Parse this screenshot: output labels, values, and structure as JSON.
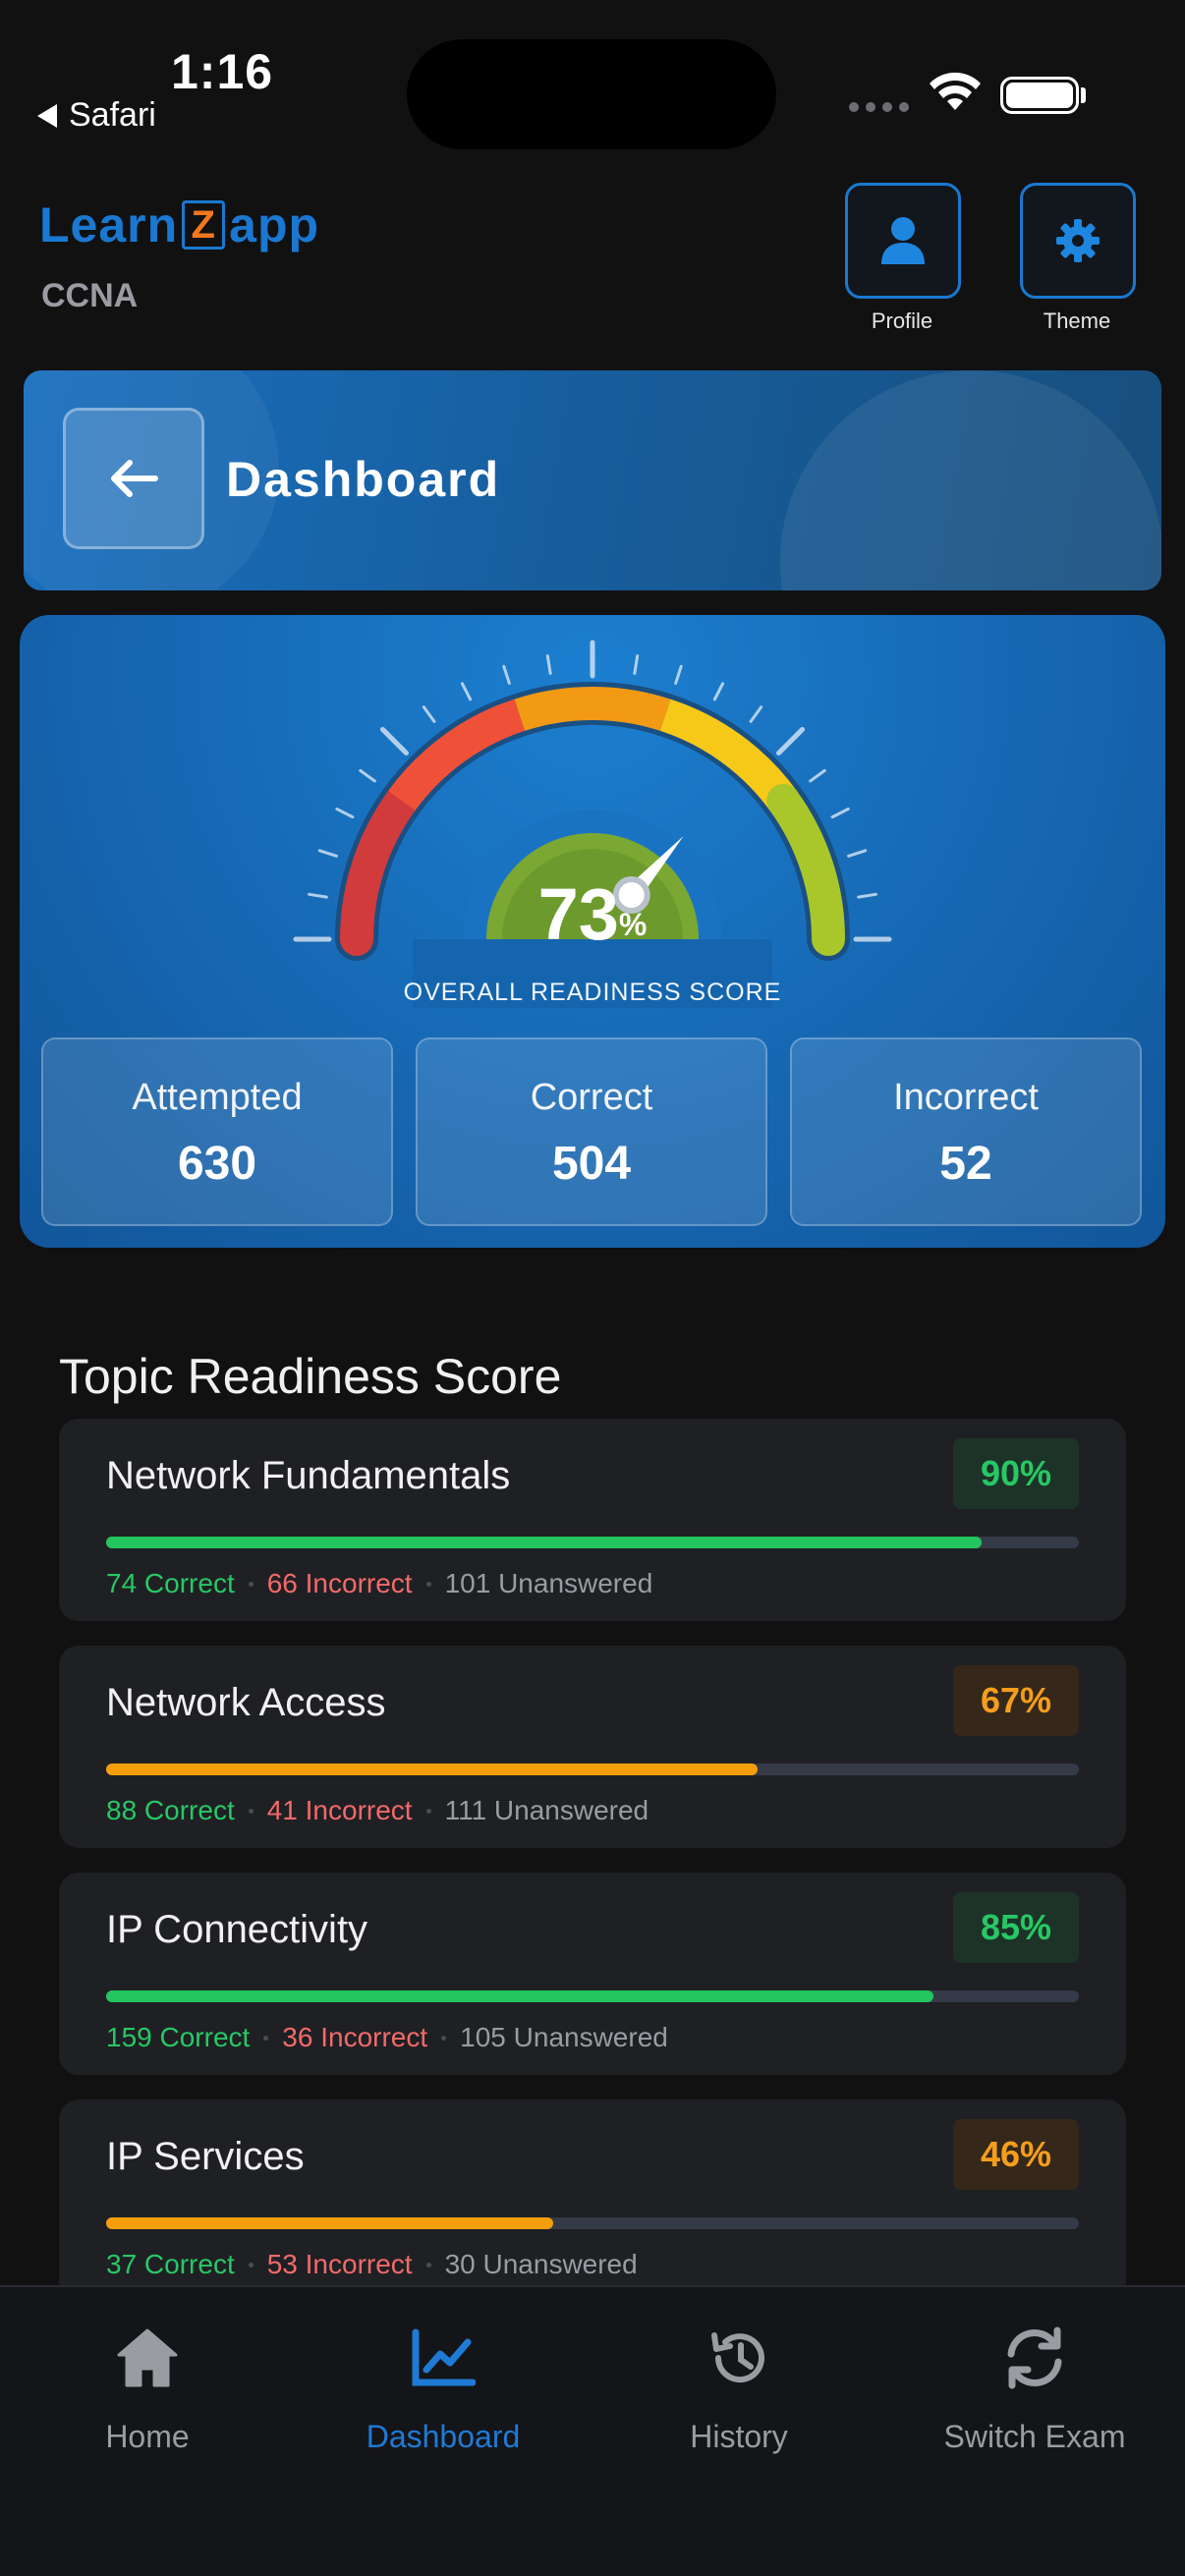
{
  "status_bar": {
    "time": "1:16",
    "back_app": "Safari"
  },
  "header": {
    "logo": {
      "part1": "Learn",
      "part2": "Z",
      "part3": "app"
    },
    "exam": "CCNA",
    "profile_label": "Profile",
    "theme_label": "Theme"
  },
  "banner": {
    "title": "Dashboard"
  },
  "readiness": {
    "score": "73",
    "unit": "%",
    "score_value": 73,
    "label": "OVERALL READINESS SCORE",
    "stats": [
      {
        "label": "Attempted",
        "value": "630"
      },
      {
        "label": "Correct",
        "value": "504"
      },
      {
        "label": "Incorrect",
        "value": "52"
      }
    ]
  },
  "topics_section": {
    "title": "Topic Readiness Score",
    "topics": [
      {
        "name": "Network Fundamentals",
        "pct": "90%",
        "progress": 0.9,
        "level": "green",
        "correct": "74 Correct",
        "incorrect": "66 Incorrect",
        "unanswered": "101 Unanswered"
      },
      {
        "name": "Network Access",
        "pct": "67%",
        "progress": 0.67,
        "level": "orange",
        "correct": "88 Correct",
        "incorrect": "41 Incorrect",
        "unanswered": "111 Unanswered"
      },
      {
        "name": "IP Connectivity",
        "pct": "85%",
        "progress": 0.85,
        "level": "green",
        "correct": "159 Correct",
        "incorrect": "36 Incorrect",
        "unanswered": "105 Unanswered"
      },
      {
        "name": "IP Services",
        "pct": "46%",
        "progress": 0.46,
        "level": "orange",
        "correct": "37 Correct",
        "incorrect": "53 Incorrect",
        "unanswered": "30 Unanswered"
      }
    ]
  },
  "bottom_nav": {
    "items": [
      {
        "label": "Home",
        "icon": "home-icon",
        "active": false
      },
      {
        "label": "Dashboard",
        "icon": "chart-line-icon",
        "active": true
      },
      {
        "label": "History",
        "icon": "history-icon",
        "active": false
      },
      {
        "label": "Switch Exam",
        "icon": "refresh-icon",
        "active": false
      }
    ]
  },
  "colors": {
    "accent": "#1a78d0",
    "green": "#23c55e",
    "orange": "#f59e0b",
    "red": "#f26a6a"
  }
}
